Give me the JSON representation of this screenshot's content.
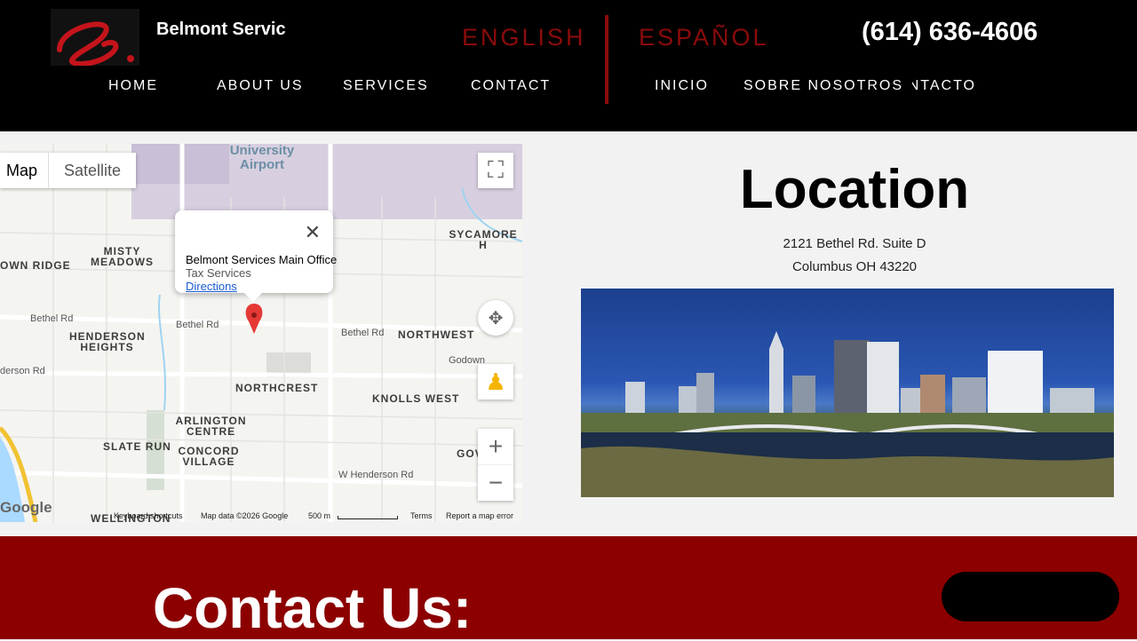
{
  "header": {
    "brand": "Belmont Servic",
    "phone": "(614) 636-4606",
    "languages": {
      "english": "ENGLISH",
      "spanish": "ESPAÑOL"
    },
    "nav_en": [
      "HOME",
      "ABOUT US",
      "SERVICES",
      "CONTACT"
    ],
    "nav_es": [
      "INICIO",
      "SOBRE NOSOTROS",
      "CONTACTO"
    ]
  },
  "map": {
    "type_map": "Map",
    "type_satellite": "Satellite",
    "popup_name": "Belmont Services Main Office",
    "popup_sub": "Tax Services",
    "popup_directions": "Directions",
    "airport": "University Airport",
    "labels": {
      "misty": "MISTY MEADOWS",
      "sycamore": "SYCAMORE H",
      "brown_ridge": "OWN RIDGE",
      "henderson": "HENDERSON HEIGHTS",
      "northwest": "NORTHWEST",
      "northcrest": "NORTHCREST",
      "knolls": "KNOLLS WEST",
      "arlington": "ARLINGTON CENTRE",
      "slate": "SLATE RUN",
      "concord": "CONCORD VILLAGE",
      "gov": "GOV",
      "wellington": "WELLINGTON"
    },
    "roads": {
      "bethel1": "Bethel Rd",
      "bethel2": "Bethel Rd",
      "bethel3": "Bethel Rd",
      "henderson_rd": "derson Rd",
      "w_henderson": "W Henderson Rd",
      "godown": "Godown"
    },
    "footer": {
      "shortcuts": "Keyboard shortcuts",
      "mapdata": "Map data ©2026 Google",
      "scale": "500 m",
      "terms": "Terms",
      "report": "Report a map error"
    },
    "google": "Google"
  },
  "location": {
    "title": "Location",
    "line1": "2121 Bethel Rd. Suite D",
    "line2": "Columbus OH 43220"
  },
  "contact": {
    "title": "Contact Us:"
  },
  "colors": {
    "accent": "#8c0b0b",
    "band": "#8c0000"
  }
}
